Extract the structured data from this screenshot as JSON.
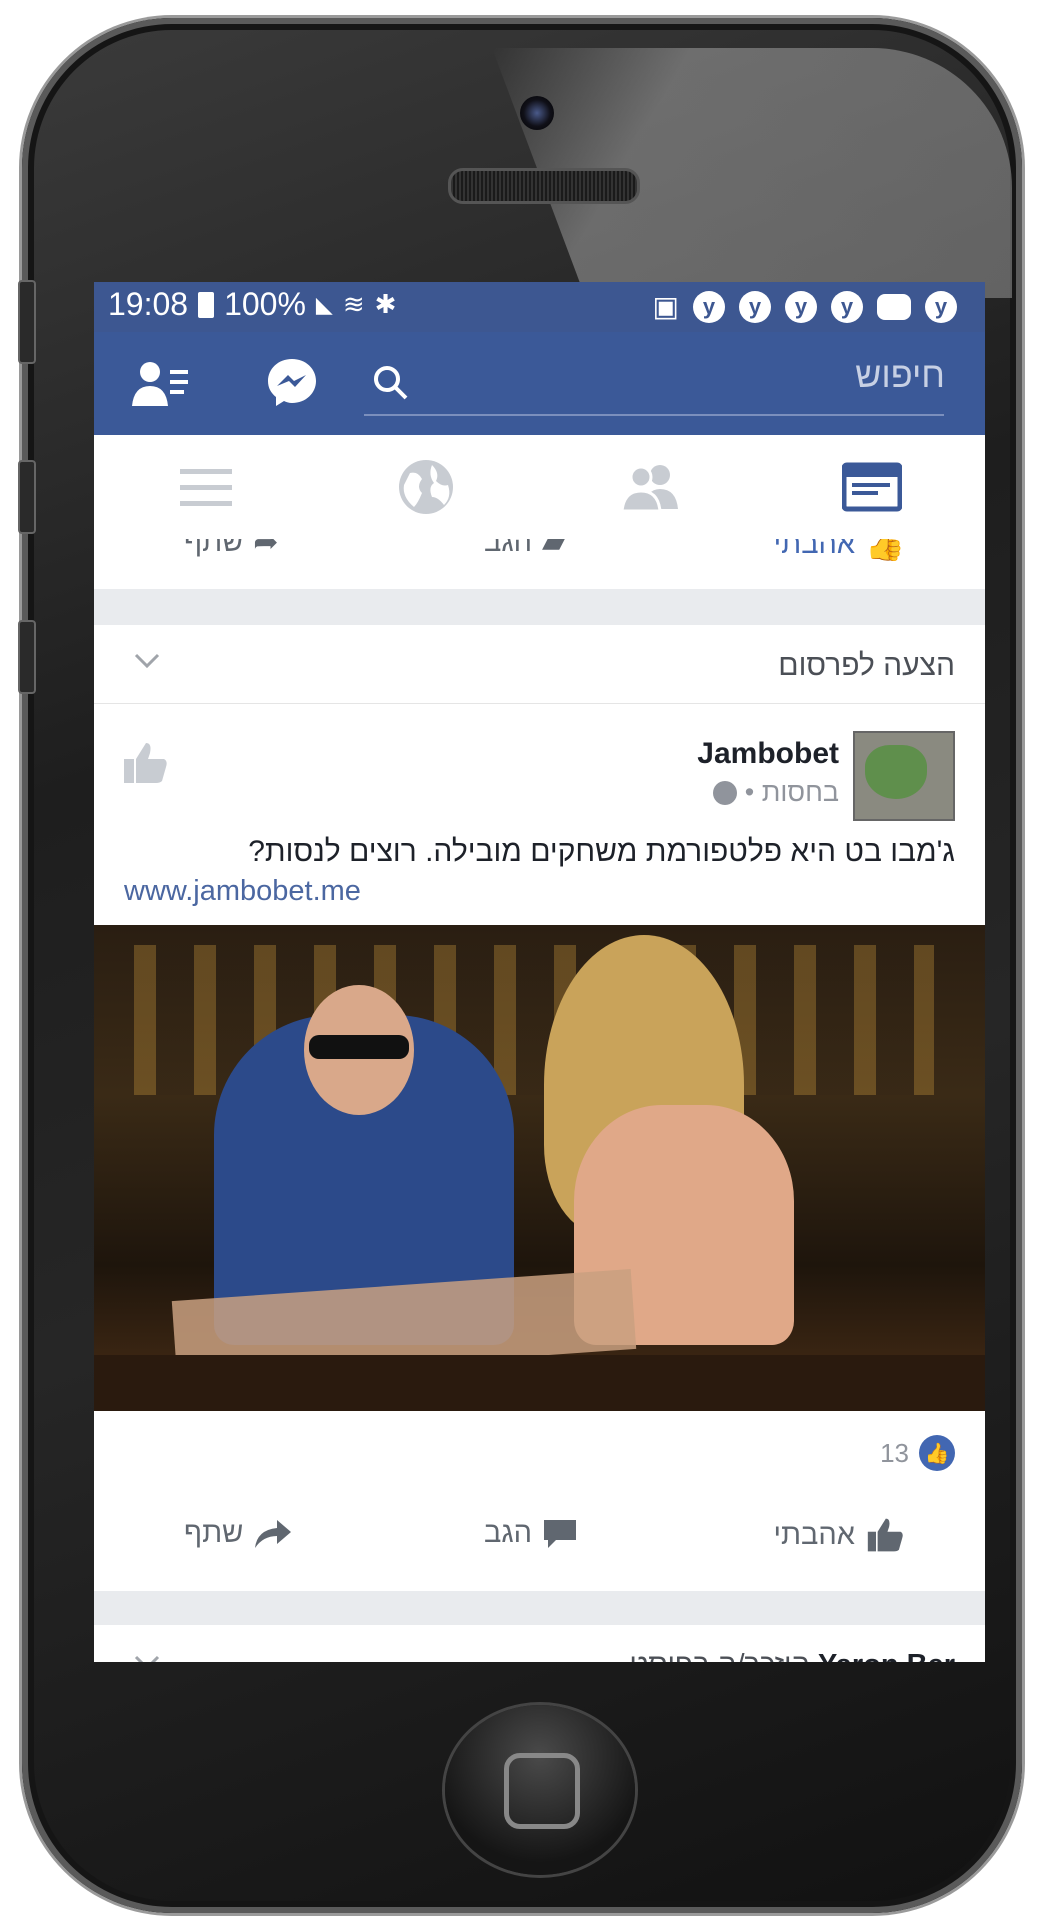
{
  "status_bar": {
    "time": "19:08",
    "battery": "100%",
    "notif_badges": [
      "y",
      "y",
      "y",
      "y",
      "y"
    ]
  },
  "navbar": {
    "search_placeholder": "חיפוש"
  },
  "prev_post_actions": {
    "like": "אהבתי",
    "comment": "הגב",
    "share": "שתף"
  },
  "ad_post": {
    "header_label": "הצעה לפרסום",
    "page_name": "Jambobet",
    "meta": "בחסות •",
    "text": "ג'מבו בט היא פלטפורמת משחקים מובילה. רוצים לנסות?",
    "link": "www.jambobet.me",
    "like_count": "13",
    "actions": {
      "like": "אהבתי",
      "comment": "הגב",
      "share": "שתף"
    }
  },
  "next_post": {
    "author": "Yaron Ber",
    "text": "הוזכר/ה בפוסט"
  },
  "colors": {
    "brand": "#3b5998",
    "status": "#3d5791",
    "link": "#4b67a1",
    "like_blue": "#4267b2"
  }
}
